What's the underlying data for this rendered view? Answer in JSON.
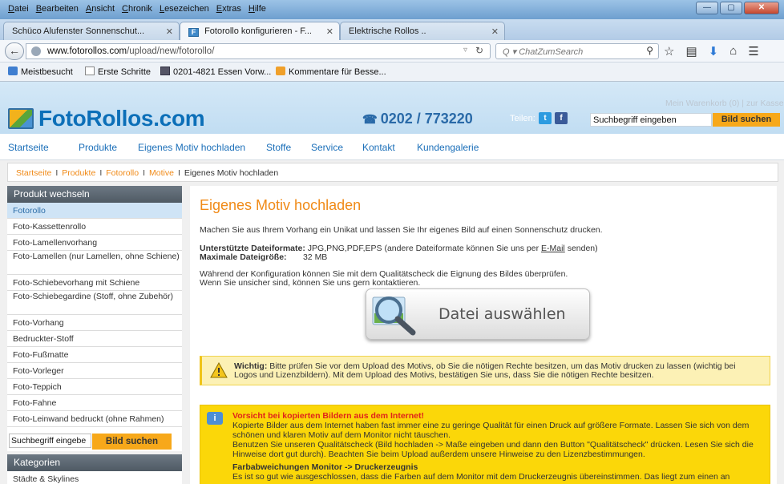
{
  "browser": {
    "menus": [
      "Datei",
      "Bearbeiten",
      "Ansicht",
      "Chronik",
      "Lesezeichen",
      "Extras",
      "Hilfe"
    ],
    "window_buttons": {
      "minimize": "—",
      "maximize": "▢",
      "close": "✕"
    },
    "tabs": [
      {
        "label": "Schüco Alufenster Sonnenschut...",
        "close": "✕"
      },
      {
        "label": "Fotorollo konfigurieren - F...",
        "close": "✕",
        "active": true,
        "favicon": "F"
      },
      {
        "label": "Elektrische Rollos ..",
        "close": "✕"
      }
    ],
    "new_tab": "+",
    "url_host": "www.fotorollos.com",
    "url_path": "/upload/new/fotorollo/",
    "search_placeholder": "ChatZumSearch",
    "search_prefix": "Q ▾",
    "bookmarks": [
      {
        "label": "Meistbesucht"
      },
      {
        "label": "Erste Schritte"
      },
      {
        "label": "0201-4821 Essen Vorw..."
      },
      {
        "label": "Kommentare für Besse..."
      }
    ],
    "colors": {
      "titlebar": "#7fb0df",
      "tab_active": "#f3f6fa"
    }
  },
  "site": {
    "logo": "FotoRollos.com",
    "phone": "0202 / 773220",
    "phone_icon": "☎",
    "share_label": "Teilen:",
    "cart": "Mein Warenkorb (0)  |  zur Kasse",
    "search_value": "Suchbegriff eingeben",
    "search_button": "Bild suchen",
    "nav": [
      "Startseite",
      "Produkte",
      "Eigenes Motiv hochladen",
      "Stoffe",
      "Service",
      "Kontakt",
      "Kundengalerie"
    ],
    "breadcrumb": {
      "items": [
        "Startseite",
        "Produkte",
        "Fotorollo",
        "Motive"
      ],
      "sep": "I",
      "current": "Eigenes Motiv hochladen"
    },
    "colors": {
      "accent": "#f08a17",
      "link": "#1b6fb9",
      "brand": "#0c6fb8",
      "button": "#f7a81a",
      "warn_bg": "#fcf1b5",
      "info_bg": "#fbd709"
    }
  },
  "sidebar": {
    "heading": "Produkt wechseln",
    "items": [
      "Fotorollo",
      "Foto-Kassettenrollo",
      "Foto-Lamellenvorhang",
      "Foto-Lamellen (nur Lamellen, ohne Schiene)",
      "Foto-Schiebevorhang mit Schiene",
      "Foto-Schiebegardine (Stoff, ohne Zubehör)",
      "Foto-Vorhang",
      "Bedruckter-Stoff",
      "Foto-Fußmatte",
      "Foto-Vorleger",
      "Foto-Teppich",
      "Foto-Fahne",
      "Foto-Leinwand bedruckt (ohne Rahmen)"
    ],
    "search_value": "Suchbegriff eingebe",
    "search_button": "Bild suchen",
    "categories_heading": "Kategorien",
    "categories": [
      "Städte & Skylines"
    ]
  },
  "content": {
    "title": "Eigenes Motiv hochladen",
    "intro": "Machen Sie aus Ihrem Vorhang ein Unikat und lassen Sie Ihr eigenes Bild auf einen Sonnenschutz drucken.",
    "formats_label": "Unterstützte Dateiformate:",
    "formats_value": "JPG,PNG,PDF,EPS (andere Dateiformate können Sie uns per",
    "formats_link": "E-Mail",
    "formats_end": "senden)",
    "size_label": "Maximale Dateigröße:",
    "size_value": "32 MB",
    "quality_1": "Während der Konfiguration können Sie mit dem Qualitätscheck die Eignung des Bildes überprüfen.",
    "quality_2": "Wenn Sie unsicher sind, können Sie uns gern kontaktieren.",
    "file_button": "Datei auswählen",
    "warning_label": "Wichtig:",
    "warning_1": "Bitte prüfen Sie vor dem Upload des Motivs, ob Sie die nötigen Rechte besitzen, um das Motiv drucken zu lassen (wichtig bei",
    "warning_2": "Logos und Lizenzbildern). Mit dem Upload des Motivs, bestätigen Sie uns, dass Sie die nötigen Rechte besitzen.",
    "info_heading": "Vorsicht bei kopierten Bildern aus dem Internet!",
    "info_1": "Kopierte Bilder aus dem Internet haben fast immer eine zu geringe Qualität für einen Druck auf größere Formate. Lassen Sie sich von dem schönen und klaren Motiv auf dem Monitor nicht täuschen.",
    "info_2": "Benutzen Sie unseren Qualitätscheck (Bild hochladen -> Maße eingeben und dann den Button \"Qualitätscheck\" drücken. Lesen Sie sich die Hinweise dort gut durch). Beachten Sie beim Upload außerdem unsere Hinweise zu den Lizenzbestimmungen.",
    "info_sub": "Farbabweichungen Monitor -> Druckerzeugnis",
    "info_3": "Es ist so gut wie ausgeschlossen, dass die Farben auf dem Monitor mit dem Druckerzeugnis übereinstimmen. Das liegt zum einen an"
  }
}
